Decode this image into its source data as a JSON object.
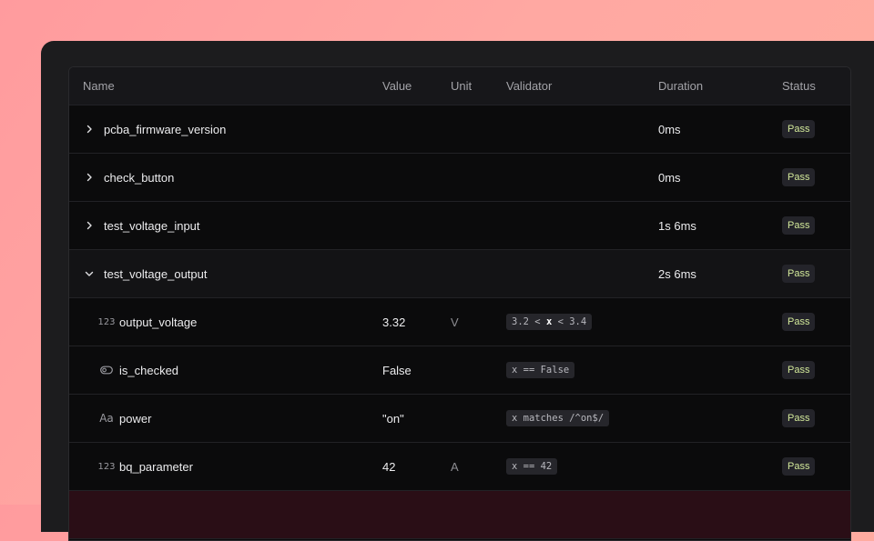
{
  "columns": {
    "name": "Name",
    "value": "Value",
    "unit": "Unit",
    "validator": "Validator",
    "duration": "Duration",
    "status": "Status"
  },
  "rows": [
    {
      "name": "pcba_firmware_version",
      "duration": "0ms",
      "status": "Pass",
      "icon": "chevron-right-icon"
    },
    {
      "name": "check_button",
      "duration": "0ms",
      "status": "Pass",
      "icon": "chevron-right-icon"
    },
    {
      "name": "test_voltage_input",
      "duration": "1s 6ms",
      "status": "Pass",
      "icon": "chevron-right-icon"
    },
    {
      "name": "test_voltage_output",
      "duration": "2s 6ms",
      "status": "Pass",
      "icon": "chevron-down-icon"
    }
  ],
  "measurements": [
    {
      "type_icon": "123",
      "icon_name": "numeric-type-icon",
      "name": "output_voltage",
      "value": "3.32",
      "unit": "V",
      "validator_pre": "3.2 < ",
      "validator_var": "x",
      "validator_post": " < 3.4",
      "status": "Pass"
    },
    {
      "type_icon": "toggle",
      "icon_name": "boolean-type-icon",
      "name": "is_checked",
      "value": "False",
      "unit": "",
      "validator": "x == False",
      "status": "Pass"
    },
    {
      "type_icon": "Aa",
      "icon_name": "text-type-icon",
      "name": "power",
      "value": "\"on\"",
      "unit": "",
      "validator": "x matches /^on$/",
      "status": "Pass"
    },
    {
      "type_icon": "123",
      "icon_name": "numeric-type-icon",
      "name": "bq_parameter",
      "value": "42",
      "unit": "A",
      "validator": "x == 42",
      "status": "Pass"
    }
  ],
  "colors": {
    "background_gradient_start": "#ff9b9e",
    "background_gradient_end": "#ffae9f",
    "panel": "#1c1c1e",
    "table": "#0b0b0c",
    "pass_text": "#d2e89a",
    "failed_row": "#2a0e16"
  }
}
